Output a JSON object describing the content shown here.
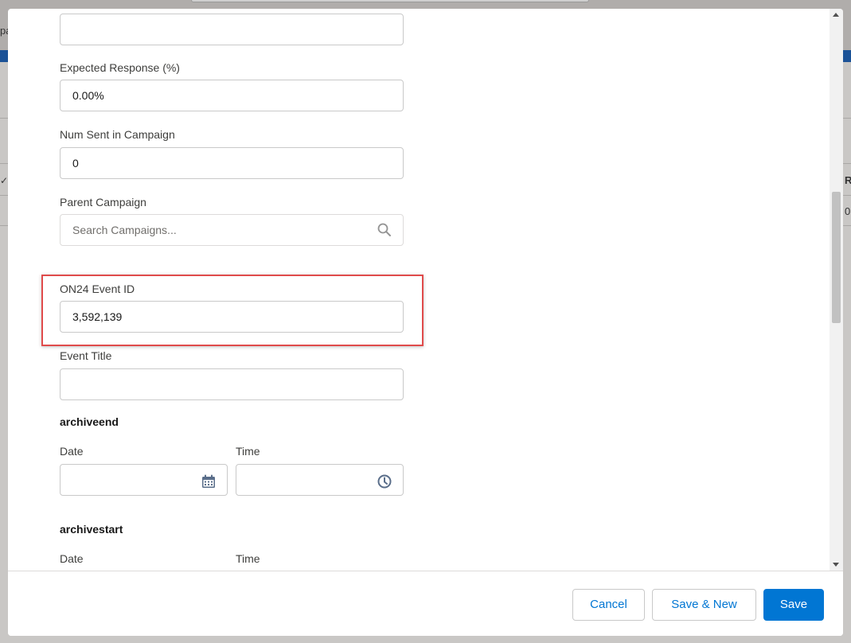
{
  "background": {
    "left_partial_text": "pa",
    "right_partial_header": "R",
    "right_partial_value": "0"
  },
  "form": {
    "top_field_value": "",
    "expected_response": {
      "label": "Expected Response (%)",
      "value": "0.00%"
    },
    "num_sent": {
      "label": "Num Sent in Campaign",
      "value": "0"
    },
    "parent_campaign": {
      "label": "Parent Campaign",
      "placeholder": "Search Campaigns...",
      "icon": "search-icon"
    },
    "on24_event_id": {
      "label": "ON24 Event ID",
      "value": "3,592,139"
    },
    "event_title": {
      "label": "Event Title",
      "value": ""
    },
    "archiveend": {
      "title": "archiveend",
      "date_label": "Date",
      "time_label": "Time",
      "date_icon": "calendar-icon",
      "time_icon": "clock-icon"
    },
    "archivestart": {
      "title": "archivestart",
      "date_label": "Date",
      "time_label": "Time"
    }
  },
  "footer": {
    "cancel_label": "Cancel",
    "save_new_label": "Save & New",
    "save_label": "Save"
  },
  "colors": {
    "brand": "#0176d3",
    "highlight": "#e04b4b",
    "icon": "#5a6e8a"
  }
}
